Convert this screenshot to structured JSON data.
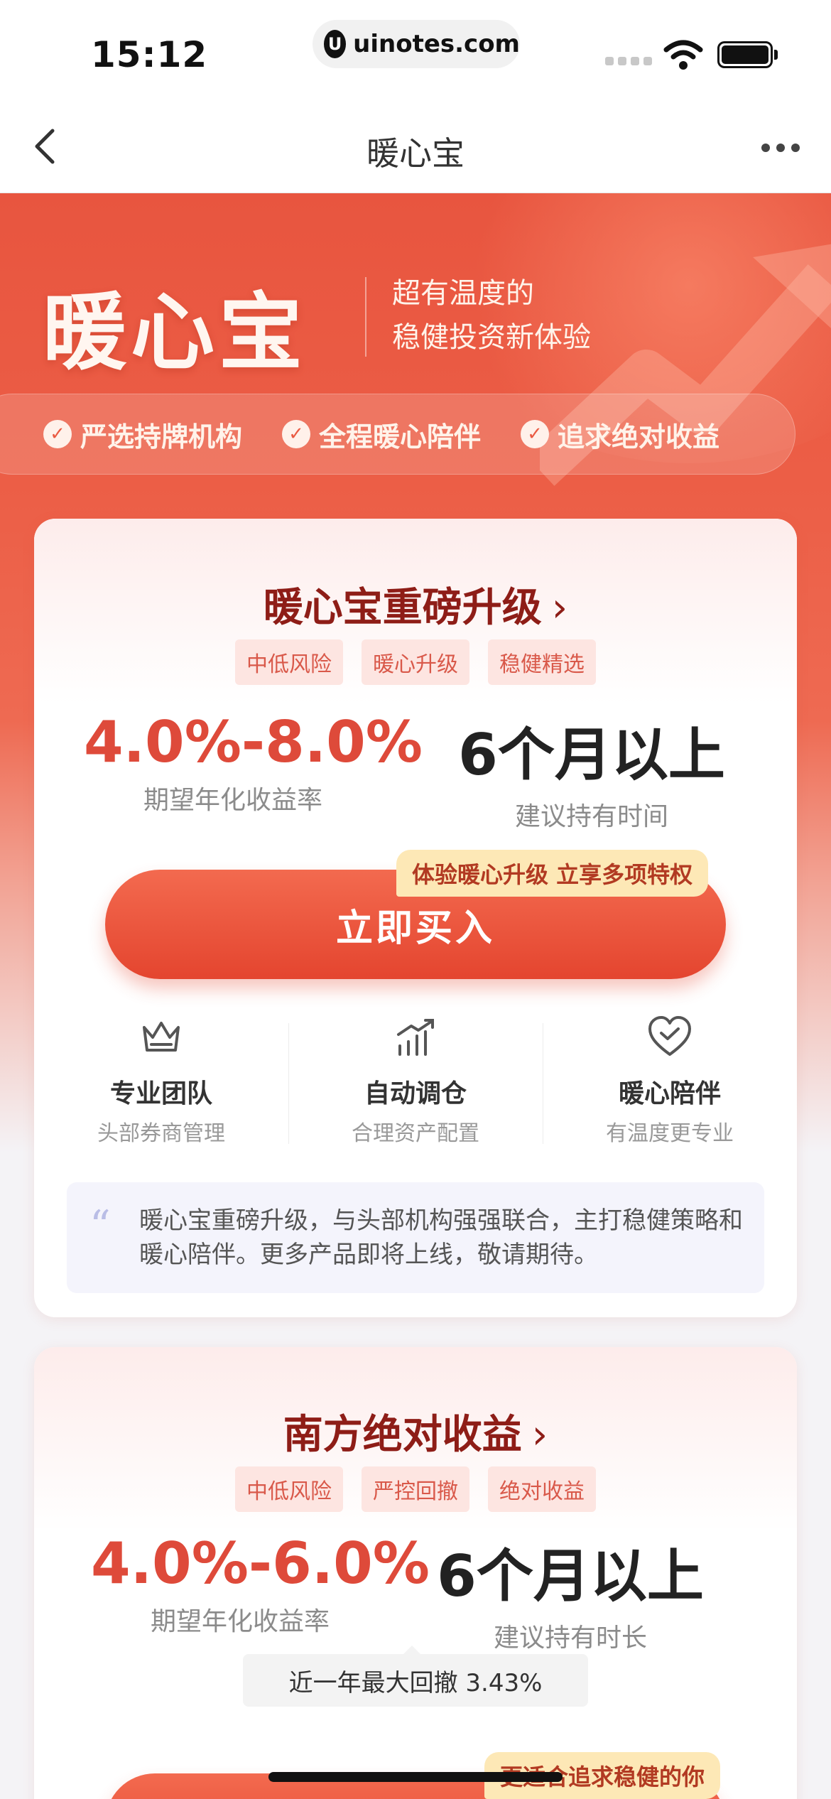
{
  "status_bar": {
    "time": "15:12",
    "url": "uinotes.com",
    "url_logo": "U"
  },
  "nav": {
    "title": "暖心宝",
    "back_icon": "chevron-left-icon",
    "more_icon": "more-horizontal-icon"
  },
  "hero": {
    "brand": "暖心宝",
    "slogan_line1": "超有温度的",
    "slogan_line2": "稳健投资新体验",
    "features": [
      {
        "label": "严选持牌机构",
        "icon": "check-circle-icon"
      },
      {
        "label": "全程暖心陪伴",
        "icon": "check-circle-icon"
      },
      {
        "label": "追求绝对收益",
        "icon": "check-circle-icon"
      }
    ]
  },
  "card1": {
    "title": "暖心宝重磅升级",
    "title_chevron": "›",
    "tags": [
      "中低风险",
      "暖心升级",
      "稳健精选"
    ],
    "return_value": "4.0%-8.0%",
    "return_label": "期望年化收益率",
    "hold_value": "6个月以上",
    "hold_label": "建议持有时间",
    "badge": "体验暖心升级 立享多项特权",
    "buy_label": "立即买入",
    "services": [
      {
        "name": "专业团队",
        "desc": "头部券商管理",
        "icon": "crown-icon"
      },
      {
        "name": "自动调仓",
        "desc": "合理资产配置",
        "icon": "growth-chart-icon"
      },
      {
        "name": "暖心陪伴",
        "desc": "有温度更专业",
        "icon": "heart-check-icon"
      }
    ],
    "quote_mark": "“",
    "quote": "暖心宝重磅升级，与头部机构强强联合，主打稳健策略和暖心陪伴。更多产品即将上线，敬请期待。"
  },
  "card2": {
    "title": "南方绝对收益",
    "title_chevron": "›",
    "tags": [
      "中低风险",
      "严控回撤",
      "绝对收益"
    ],
    "return_value": "4.0%-6.0%",
    "return_label": "期望年化收益率",
    "hold_value": "6个月以上",
    "hold_label": "建议持有时长",
    "drawdown": "近一年最大回撤 3.43%",
    "badge": "更适合追求稳健的你"
  },
  "colors": {
    "brand_red": "#e4452f",
    "title_red": "#8e1d17",
    "badge_yellow": "#fde8b6"
  }
}
